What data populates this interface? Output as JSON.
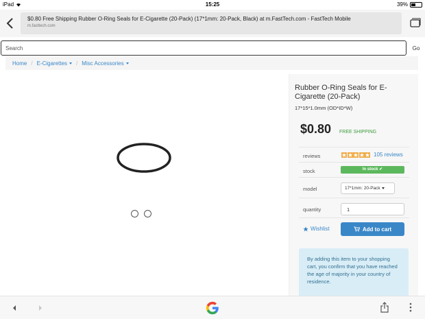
{
  "status": {
    "device": "iPad",
    "time": "15:25",
    "battery": "39%"
  },
  "browser": {
    "page_title": "$0.80 Free Shipping Rubber O-Ring Seals for E-Cigarette (20-Pack) (17*1mm: 20-Pack, Black) at m.FastTech.com - FastTech Mobile",
    "domain": "m.fasttech.com"
  },
  "search": {
    "placeholder": "Search",
    "go_label": "Go"
  },
  "breadcrumb": {
    "home": "Home",
    "level1": "E-Cigarettes",
    "level2": "Misc Accessories"
  },
  "product": {
    "title": "Rubber O-Ring Seals for E-Cigarette (20-Pack)",
    "spec": "17*15*1.0mm (OD*ID*W)",
    "price": "$0.80",
    "shipping": "FREE SHIPPING",
    "reviews_label": "reviews",
    "rating": 5,
    "reviews_count": "105 reviews",
    "stock_label": "stock",
    "stock_status": "In stock ✔",
    "model_label": "model",
    "model_value": "17*1mm: 20-Pack",
    "quantity_label": "quantity",
    "quantity_value": "1",
    "wishlist_label": "Wishlist",
    "add_to_cart_label": "Add to cart",
    "notice": "By adding this item to your shopping cart, you confirm that you have reached the age of majority in your country of residence.",
    "image_count": 2
  },
  "colors": {
    "accent": "#3a87c8",
    "price_green": "#3c9a3c",
    "stock_green": "#5cb85c",
    "notice_bg": "#d9edf7",
    "star": "#f0ad4e"
  }
}
